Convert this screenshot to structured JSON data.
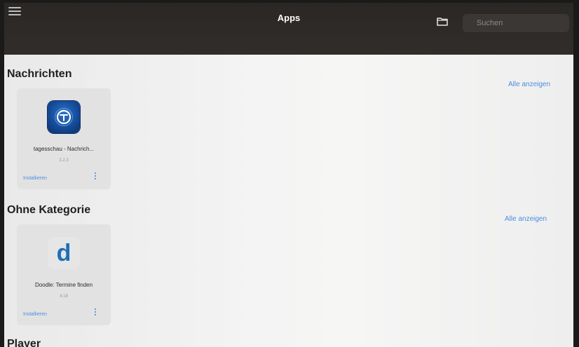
{
  "header": {
    "title": "Apps",
    "menu_icon": "hamburger-menu-icon",
    "folder_icon": "folder-icon",
    "search_placeholder": "Suchen"
  },
  "sections": [
    {
      "title": "Nachrichten",
      "show_all": "Alle anzeigen",
      "apps": [
        {
          "name": "tagesschau - Nachrich...",
          "version": "3.2.3",
          "install": "Installieren",
          "icon": "tagesschau-app-icon"
        }
      ]
    },
    {
      "title": "Ohne Kategorie",
      "show_all": "Alle anzeigen",
      "apps": [
        {
          "name": "Doodle: Termine finden",
          "version": "4.18",
          "install": "Installieren",
          "icon": "doodle-app-icon",
          "icon_letter": "d"
        }
      ]
    },
    {
      "title": "Player"
    }
  ],
  "colors": {
    "topbar": "#2e2a27",
    "accent": "#4a8ee0",
    "background": "#f0f0f0"
  }
}
